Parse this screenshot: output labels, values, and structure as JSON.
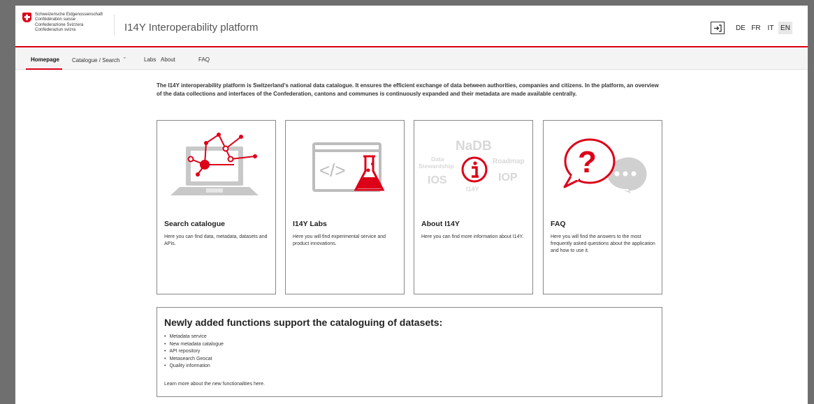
{
  "header": {
    "confederation_lines": [
      "Schweizerische Eidgenossenschaft",
      "Confédération suisse",
      "Confederazione Svizzera",
      "Confederaziun svizra"
    ],
    "app_title": "I14Y Interoperability platform",
    "login_icon": "login-icon",
    "languages": [
      "DE",
      "FR",
      "IT",
      "EN"
    ],
    "active_language": "EN"
  },
  "nav": {
    "items": [
      "Homepage",
      "Catalogue / Search",
      "Labs",
      "About",
      "FAQ"
    ],
    "active": "Homepage",
    "dropdown_glyph": "ˇ"
  },
  "intro": "The I14Y interoperability platform is Switzerland's national data catalogue. It ensures the efficient exchange of data between authorities, companies and citizens. In the platform, an overview of the data collections and interfaces of the Confederation, cantons and communes is continuously expanded and their metadata are made available centrally.",
  "cards": [
    {
      "title": "Search catalogue",
      "desc": "Here you can find data, metadata, datasets and APIs.",
      "icon": "laptop-network-icon"
    },
    {
      "title": "I14Y Labs",
      "desc": "Here you will find experimental service and product innovations.",
      "icon": "code-flask-icon"
    },
    {
      "title": "About I14Y",
      "desc": "Here you can find more information about I14Y.",
      "icon": "info-wordcloud-icon",
      "cloud_words": [
        "NaDB",
        "Data",
        "Stewardship",
        "Roadmap",
        "IOS",
        "IOP",
        "I14Y"
      ]
    },
    {
      "title": "FAQ",
      "desc": "Here you will find the answers to the most frequently asked questions about the application and how to use it.",
      "icon": "question-bubble-icon"
    }
  ],
  "news": {
    "title": "Newly added functions support the cataloguing of datasets:",
    "items": [
      "Metadata service",
      "New metadata catalogue",
      "API repository",
      "Metasearch Geocat",
      "Quality information"
    ],
    "more": "Learn more about the new functionalities here."
  },
  "colors": {
    "accent": "#dc0018",
    "grey_illustration": "#c8c8c8",
    "nav_bg": "#f4f4f4"
  }
}
